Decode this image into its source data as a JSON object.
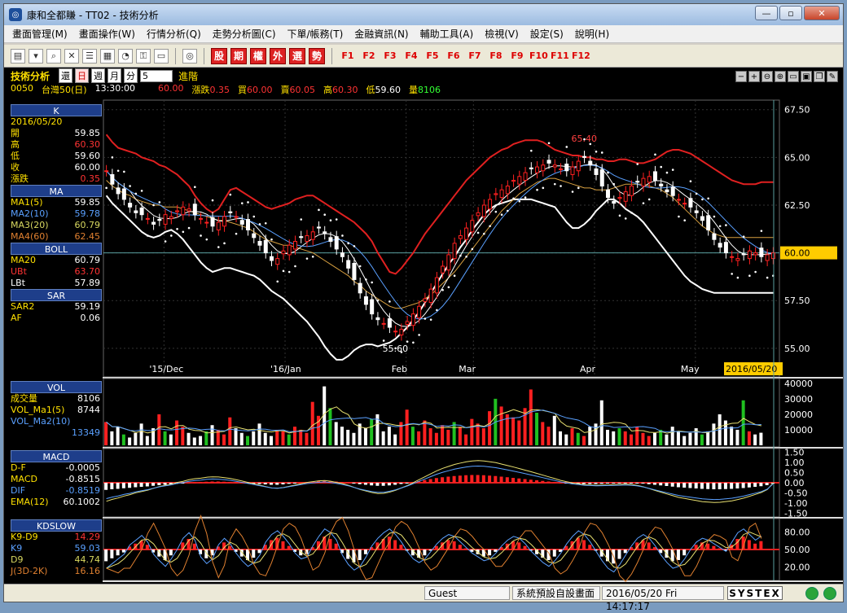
{
  "window": {
    "title": "康和全都賺 - TT02 - 技術分析",
    "icon": "app-logo-icon",
    "controls": [
      "minimize-icon",
      "maximize-icon",
      "close-icon"
    ]
  },
  "menu": [
    "畫面管理(M)",
    "畫面操作(W)",
    "行情分析(Q)",
    "走勢分析圖(C)",
    "下單/帳務(T)",
    "金融資訊(N)",
    "輔助工具(A)",
    "檢視(V)",
    "設定(S)",
    "說明(H)"
  ],
  "toolbar": {
    "icons": [
      "chart-icon",
      "window-icon",
      "search-icon",
      "close-icon",
      "list-icon",
      "grid-icon",
      "gauge-icon",
      "key-icon",
      "note-icon",
      "logo-icon"
    ],
    "red_buttons": [
      "股",
      "期",
      "權",
      "外",
      "選",
      "勢"
    ],
    "fkeys": [
      "F1",
      "F2",
      "F3",
      "F4",
      "F5",
      "F6",
      "F7",
      "F8",
      "F9",
      "F10",
      "F11",
      "F12"
    ]
  },
  "header": {
    "title": "技術分析",
    "periods": [
      "還",
      "日",
      "週",
      "月",
      "分"
    ],
    "active_period": "日",
    "minute_value": "5",
    "advanced": "進階",
    "code": "0050",
    "name": "台灣50(日)",
    "time": "13:30:00",
    "price": "60.00",
    "change_label": "漲跌",
    "change": "0.35",
    "bid_label": "買",
    "bid": "60.00",
    "ask_label": "賣",
    "ask": "60.05",
    "high_label": "高",
    "high": "60.30",
    "low_label": "低",
    "low": "59.60",
    "vol_label": "量",
    "vol": "8106",
    "controls": [
      "zoom-out-icon",
      "zoom-in-icon",
      "magnify-minus-icon",
      "magnify-plus-icon",
      "chat-icon",
      "save-icon",
      "copy-icon",
      "tools-icon"
    ]
  },
  "panels": {
    "k": {
      "title": "K",
      "date": "2016/05/20",
      "rows": [
        [
          "開",
          "59.85"
        ],
        [
          "高",
          "60.30"
        ],
        [
          "低",
          "59.60"
        ],
        [
          "收",
          "60.00"
        ],
        [
          "漲跌",
          "0.35"
        ]
      ]
    },
    "ma": {
      "title": "MA",
      "rows": [
        [
          "MA1(5)",
          "59.85"
        ],
        [
          "MA2(10)",
          "59.78"
        ],
        [
          "MA3(20)",
          "60.79"
        ],
        [
          "MA4(60)",
          "62.45"
        ]
      ]
    },
    "boll": {
      "title": "BOLL",
      "rows": [
        [
          "MA20",
          "60.79"
        ],
        [
          "UBt",
          "63.70"
        ],
        [
          "LBt",
          "57.89"
        ]
      ]
    },
    "sar": {
      "title": "SAR",
      "rows": [
        [
          "SAR2",
          "59.19"
        ],
        [
          "AF",
          "0.06"
        ]
      ]
    },
    "vol": {
      "title": "VOL",
      "rows": [
        [
          "成交量",
          "8106"
        ],
        [
          "VOL_Ma1(5)",
          "8744"
        ],
        [
          "VOL_Ma2(10)",
          ""
        ],
        [
          "",
          "13349"
        ]
      ]
    },
    "macd": {
      "title": "MACD",
      "rows": [
        [
          "D-F",
          "-0.0005"
        ],
        [
          "MACD",
          "-0.8515"
        ],
        [
          "DIF",
          "-0.8519"
        ],
        [
          "EMA(12)",
          "60.1002"
        ]
      ]
    },
    "kd": {
      "title": "KDSLOW",
      "rows": [
        [
          "K9-D9",
          "14.29"
        ],
        [
          "K9",
          "59.03"
        ],
        [
          "D9",
          "44.74"
        ],
        [
          "J(3D-2K)",
          "16.16"
        ]
      ]
    }
  },
  "chart_data": [
    {
      "type": "candlestick",
      "y_ticks": [
        "67.50",
        "65.00",
        "62.50",
        "60.00",
        "57.50",
        "55.00"
      ],
      "ylim": [
        53.5,
        68.0
      ],
      "x_labels": [
        "'15/Dec",
        "'16/Jan",
        "Feb",
        "Mar",
        "Apr",
        "May"
      ],
      "current_date": "2016/05/20",
      "last_price": "60.00",
      "annotations": [
        {
          "text": "65.40",
          "value": 65.4
        },
        {
          "text": "55.60",
          "value": 55.6
        }
      ],
      "closes": [
        64.3,
        63.6,
        63.1,
        62.8,
        62.4,
        62.1,
        62.0,
        61.8,
        61.5,
        61.7,
        62.0,
        61.9,
        62.2,
        62.4,
        62.3,
        62.0,
        61.8,
        61.6,
        61.4,
        61.6,
        61.9,
        62.1,
        61.9,
        61.5,
        61.2,
        60.8,
        60.4,
        60.0,
        59.6,
        59.7,
        60.1,
        60.4,
        60.6,
        60.8,
        60.9,
        61.1,
        61.3,
        61.0,
        60.6,
        60.2,
        59.8,
        59.2,
        58.6,
        57.9,
        57.3,
        56.8,
        56.5,
        56.3,
        56.1,
        55.9,
        56.0,
        56.4,
        56.8,
        57.2,
        57.6,
        58.1,
        58.7,
        59.3,
        59.9,
        60.5,
        60.9,
        61.3,
        61.7,
        62.1,
        62.5,
        62.8,
        63.1,
        63.3,
        63.5,
        63.8,
        64.0,
        64.2,
        64.4,
        64.5,
        64.6,
        64.7,
        64.6,
        64.4,
        64.3,
        64.5,
        64.8,
        65.0,
        64.6,
        64.1,
        63.5,
        62.9,
        62.6,
        62.9,
        63.2,
        63.5,
        63.7,
        63.9,
        64.0,
        63.8,
        63.5,
        63.2,
        63.0,
        62.8,
        62.6,
        62.4,
        62.1,
        61.7,
        61.2,
        60.7,
        60.3,
        60.0,
        59.8,
        59.7,
        59.9,
        60.1,
        60.0,
        59.8,
        59.9,
        60.0
      ],
      "upper_band": [
        66.2,
        65.8,
        65.5,
        65.4,
        65.3,
        65.2,
        65.0,
        64.9,
        64.8,
        64.6,
        64.5,
        64.3,
        64.1,
        63.8,
        63.5,
        63.0,
        62.6,
        62.3,
        62.1,
        62.3,
        62.8,
        63.3,
        63.4,
        63.2,
        63.0,
        62.8,
        62.6,
        62.4,
        62.3,
        62.4,
        62.5,
        62.6,
        62.8,
        62.9,
        63.0,
        63.0,
        62.8,
        62.6,
        62.4,
        62.2,
        62.0,
        61.8,
        61.6,
        61.3,
        61.0,
        60.6,
        60.0,
        59.5,
        59.0,
        58.9,
        59.2,
        59.6,
        60.0,
        60.5,
        61.0,
        61.4,
        61.8,
        62.2,
        62.6,
        63.0,
        63.4,
        63.8,
        64.1,
        64.4,
        64.7,
        65.0,
        65.2,
        65.4,
        65.5,
        65.7,
        65.8,
        65.9,
        65.9,
        65.9,
        65.8,
        65.6,
        65.4,
        65.3,
        65.2,
        65.1,
        65.1,
        65.0,
        65.0,
        64.9,
        64.9,
        64.8,
        64.8,
        64.9,
        64.9,
        64.8,
        64.7,
        64.7,
        64.8,
        64.9,
        65.1,
        65.3,
        65.4,
        65.4,
        65.3,
        65.2,
        65.0,
        64.8,
        64.6,
        64.4,
        64.2,
        64.0,
        63.8,
        63.7,
        63.6,
        63.6,
        63.6,
        63.7,
        63.7,
        63.7
      ],
      "lower_band": [
        63.0,
        62.6,
        62.3,
        62.0,
        61.7,
        61.4,
        61.1,
        60.9,
        60.8,
        60.9,
        61.1,
        61.2,
        61.0,
        60.7,
        60.3,
        59.9,
        59.5,
        59.2,
        59.0,
        59.1,
        59.2,
        59.2,
        59.1,
        59.0,
        58.9,
        58.8,
        58.6,
        58.3,
        58.0,
        57.8,
        57.6,
        57.3,
        57.0,
        56.7,
        56.4,
        56.0,
        55.6,
        55.1,
        54.7,
        54.4,
        54.4,
        54.6,
        54.9,
        55.1,
        55.2,
        55.2,
        55.1,
        55.2,
        55.3,
        55.5,
        55.8,
        56.1,
        56.5,
        56.9,
        57.4,
        57.9,
        58.4,
        58.9,
        59.4,
        59.8,
        60.3,
        60.7,
        61.2,
        61.6,
        62.0,
        62.3,
        62.5,
        62.6,
        62.7,
        62.8,
        62.8,
        62.8,
        62.8,
        62.7,
        62.6,
        62.5,
        62.4,
        62.0,
        61.6,
        61.3,
        61.3,
        61.5,
        61.8,
        62.2,
        62.5,
        62.8,
        62.8,
        62.6,
        62.3,
        62.1,
        61.9,
        61.6,
        61.2,
        60.8,
        60.4,
        60.0,
        59.6,
        59.2,
        58.8,
        58.5,
        58.3,
        58.1,
        58.0,
        57.9,
        57.9,
        57.9,
        57.9,
        57.9,
        57.9,
        57.9,
        57.9,
        57.9,
        57.9,
        57.9
      ],
      "ma20": [
        63.8,
        63.5,
        63.3,
        63.1,
        63.0,
        62.8,
        62.7,
        62.6,
        62.5,
        62.5,
        62.4,
        62.4,
        62.4,
        62.3,
        62.2,
        62.1,
        62.0,
        61.9,
        61.8,
        61.7,
        61.7,
        61.6,
        61.5,
        61.4,
        61.3,
        61.1,
        60.9,
        60.7,
        60.6,
        60.5,
        60.4,
        60.4,
        60.3,
        60.2,
        60.1,
        60.0,
        59.8,
        59.6,
        59.4,
        59.2,
        59.0,
        58.8,
        58.5,
        58.3,
        58.0,
        57.8,
        57.6,
        57.4,
        57.2,
        57.1,
        57.1,
        57.2,
        57.3,
        57.4,
        57.6,
        57.8,
        58.1,
        58.4,
        58.7,
        59.0,
        59.4,
        59.8,
        60.2,
        60.6,
        61.0,
        61.4,
        61.8,
        62.2,
        62.5,
        62.8,
        63.1,
        63.3,
        63.5,
        63.7,
        63.8,
        63.9,
        63.9,
        63.8,
        63.7,
        63.6,
        63.5,
        63.4,
        63.4,
        63.3,
        63.3,
        63.3,
        63.4,
        63.5,
        63.6,
        63.6,
        63.6,
        63.6,
        63.5,
        63.4,
        63.3,
        63.1,
        62.9,
        62.6,
        62.3,
        62.0,
        61.7,
        61.4,
        61.2,
        61.0,
        60.9,
        60.8,
        60.8,
        60.8,
        60.8,
        60.8,
        60.8,
        60.8,
        60.8,
        60.8
      ]
    },
    {
      "type": "bar",
      "name": "VOL",
      "y_ticks": [
        "40000",
        "30000",
        "20000",
        "10000"
      ],
      "ylim": [
        0,
        42000
      ],
      "values": [
        15000,
        9000,
        12000,
        7000,
        5000,
        8000,
        14000,
        6000,
        11000,
        20000,
        9000,
        7000,
        16000,
        12000,
        8000,
        5000,
        6000,
        9000,
        13000,
        10000,
        7000,
        18000,
        11000,
        8000,
        6000,
        9000,
        14000,
        8000,
        6000,
        10000,
        9000,
        7000,
        12000,
        10000,
        8000,
        28000,
        19000,
        38000,
        24000,
        15000,
        12000,
        10000,
        8000,
        14000,
        11000,
        17000,
        20000,
        9000,
        12000,
        7000,
        15000,
        23000,
        12000,
        9000,
        16000,
        11000,
        8000,
        13000,
        10000,
        15000,
        12000,
        7000,
        17000,
        14000,
        11000,
        22000,
        30000,
        25000,
        20000,
        18000,
        16000,
        24000,
        36000,
        21000,
        15000,
        12000,
        19000,
        9000,
        7000,
        11000,
        8000,
        6000,
        12000,
        14000,
        29000,
        10000,
        9000,
        11000,
        9000,
        7000,
        12000,
        8000,
        6000,
        8000,
        10000,
        7000,
        12000,
        9000,
        6000,
        8000,
        11000,
        7000,
        9000,
        14000,
        20000,
        16000,
        12000,
        10000,
        29000,
        9000,
        7000,
        8106
      ],
      "colors_up": true
    },
    {
      "type": "bar",
      "name": "MACD",
      "y_ticks": [
        "1.50",
        "1.00",
        "0.50",
        "0.00",
        "-0.50",
        "-1.00",
        "-1.50"
      ],
      "ylim": [
        -1.6,
        1.6
      ],
      "values": [
        -0.35,
        -0.32,
        -0.3,
        -0.27,
        -0.25,
        -0.22,
        -0.2,
        -0.18,
        -0.15,
        -0.12,
        -0.1,
        -0.08,
        -0.05,
        -0.03,
        0.0,
        0.02,
        0.03,
        0.05,
        0.06,
        0.06,
        0.05,
        0.04,
        0.02,
        0.0,
        -0.02,
        -0.04,
        -0.06,
        -0.08,
        -0.1,
        -0.1,
        -0.08,
        -0.05,
        -0.02,
        0.01,
        0.04,
        0.06,
        0.08,
        0.09,
        0.08,
        0.06,
        0.04,
        0.01,
        -0.03,
        -0.07,
        -0.1,
        -0.13,
        -0.15,
        -0.15,
        -0.13,
        -0.1,
        -0.06,
        -0.02,
        0.03,
        0.08,
        0.13,
        0.18,
        0.23,
        0.27,
        0.3,
        0.33,
        0.35,
        0.37,
        0.38,
        0.38,
        0.37,
        0.35,
        0.33,
        0.3,
        0.27,
        0.24,
        0.21,
        0.18,
        0.15,
        0.12,
        0.09,
        0.06,
        0.03,
        0.0,
        -0.02,
        -0.04,
        -0.05,
        -0.06,
        -0.06,
        -0.06,
        -0.05,
        -0.04,
        -0.03,
        -0.02,
        -0.01,
        -0.01,
        -0.02,
        -0.04,
        -0.07,
        -0.1,
        -0.13,
        -0.16,
        -0.19,
        -0.22,
        -0.24,
        -0.26,
        -0.28,
        -0.3,
        -0.31,
        -0.32,
        -0.32,
        -0.31,
        -0.3,
        -0.28,
        -0.26,
        -0.23,
        -0.2,
        -0.17,
        -0.12,
        -0.0005
      ]
    },
    {
      "type": "bar",
      "name": "KDSLOW",
      "y_ticks": [
        "80.00",
        "50.00",
        "20.00"
      ],
      "ylim": [
        0,
        100
      ],
      "values": [
        -20,
        -15,
        -10,
        -5,
        5,
        10,
        15,
        8,
        -5,
        -12,
        -18,
        -10,
        0,
        12,
        18,
        10,
        -8,
        -15,
        -10,
        5,
        12,
        6,
        -4,
        -12,
        -18,
        -14,
        -6,
        8,
        16,
        20,
        14,
        6,
        -4,
        -10,
        -8,
        4,
        14,
        22,
        18,
        10,
        -6,
        -16,
        -22,
        -18,
        -8,
        4,
        12,
        18,
        22,
        16,
        8,
        -2,
        -10,
        -14,
        -10,
        -2,
        6,
        12,
        16,
        14,
        8,
        2,
        -4,
        -8,
        -12,
        -10,
        -4,
        4,
        10,
        14,
        12,
        6,
        -2,
        -8,
        -14,
        -18,
        -12,
        -4,
        6,
        14,
        20,
        16,
        8,
        -2,
        -12,
        -20,
        -24,
        -16,
        -6,
        4,
        12,
        16,
        12,
        4,
        -6,
        -14,
        -20,
        -18,
        -10,
        0,
        8,
        12,
        10,
        6,
        2,
        -2,
        8,
        18,
        22,
        16,
        10,
        14.29
      ]
    }
  ],
  "status": {
    "user": "Guest",
    "screen": "系統預設自設畫面",
    "datetime": "2016/05/20 Fri 14:17:17",
    "brand": "SYSTEX"
  }
}
